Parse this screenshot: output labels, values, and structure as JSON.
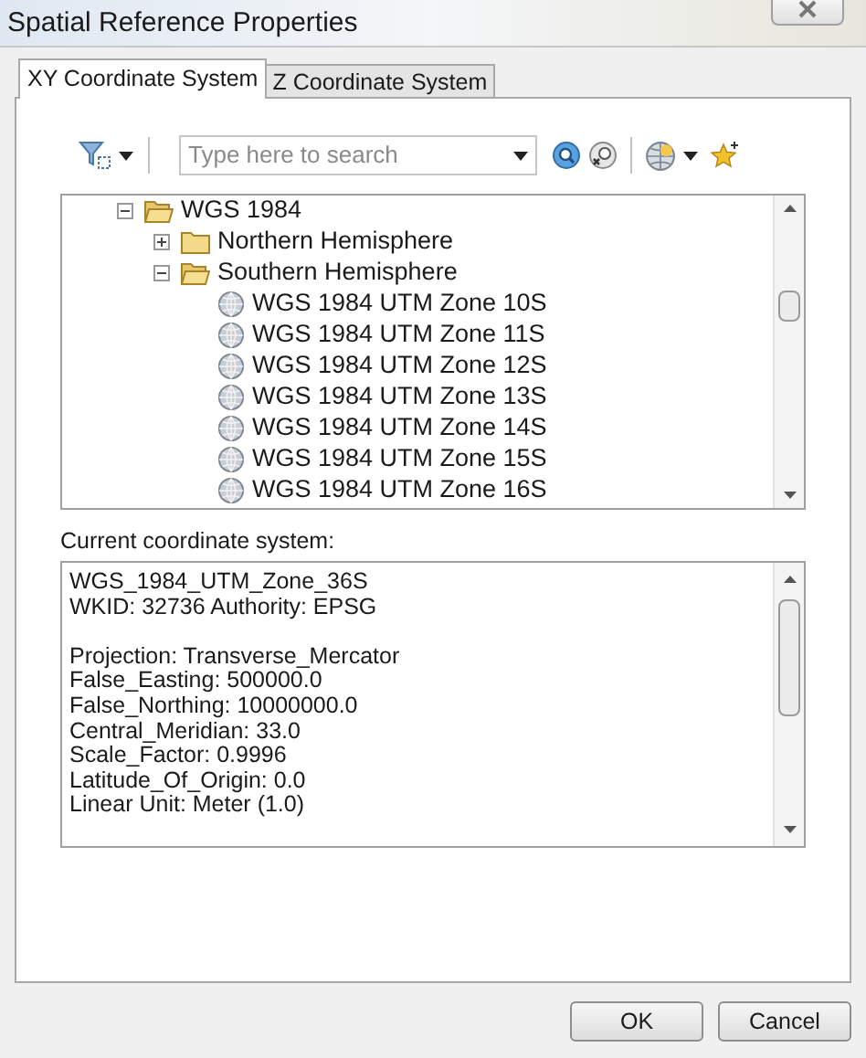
{
  "window": {
    "title": "Spatial Reference Properties"
  },
  "tabs": [
    {
      "label": "XY Coordinate System",
      "selected": true
    },
    {
      "label": "Z Coordinate System",
      "selected": false
    }
  ],
  "toolbar": {
    "search": {
      "placeholder": "Type here to search"
    }
  },
  "tree": {
    "items": [
      {
        "label": "WGS 1984",
        "kind": "folder",
        "expanded": true,
        "children": [
          {
            "label": "Northern Hemisphere",
            "kind": "folder",
            "expanded": false
          },
          {
            "label": "Southern Hemisphere",
            "kind": "folder",
            "expanded": true,
            "children": [
              {
                "label": "WGS 1984 UTM Zone 10S",
                "kind": "coordinate_system"
              },
              {
                "label": "WGS 1984 UTM Zone 11S",
                "kind": "coordinate_system"
              },
              {
                "label": "WGS 1984 UTM Zone 12S",
                "kind": "coordinate_system"
              },
              {
                "label": "WGS 1984 UTM Zone 13S",
                "kind": "coordinate_system"
              },
              {
                "label": "WGS 1984 UTM Zone 14S",
                "kind": "coordinate_system"
              },
              {
                "label": "WGS 1984 UTM Zone 15S",
                "kind": "coordinate_system"
              },
              {
                "label": "WGS 1984 UTM Zone 16S",
                "kind": "coordinate_system"
              }
            ]
          }
        ]
      }
    ]
  },
  "current": {
    "label": "Current coordinate system:",
    "paragraphs": [
      [
        "WGS_1984_UTM_Zone_36S",
        "WKID: 32736 Authority: EPSG"
      ],
      [
        "Projection: Transverse_Mercator",
        "False_Easting: 500000.0",
        "False_Northing: 10000000.0",
        "Central_Meridian: 33.0",
        "Scale_Factor: 0.9996",
        "Latitude_Of_Origin: 0.0",
        "Linear Unit: Meter (1.0)"
      ]
    ]
  },
  "buttons": [
    {
      "label": "OK"
    },
    {
      "label": "Cancel"
    }
  ]
}
